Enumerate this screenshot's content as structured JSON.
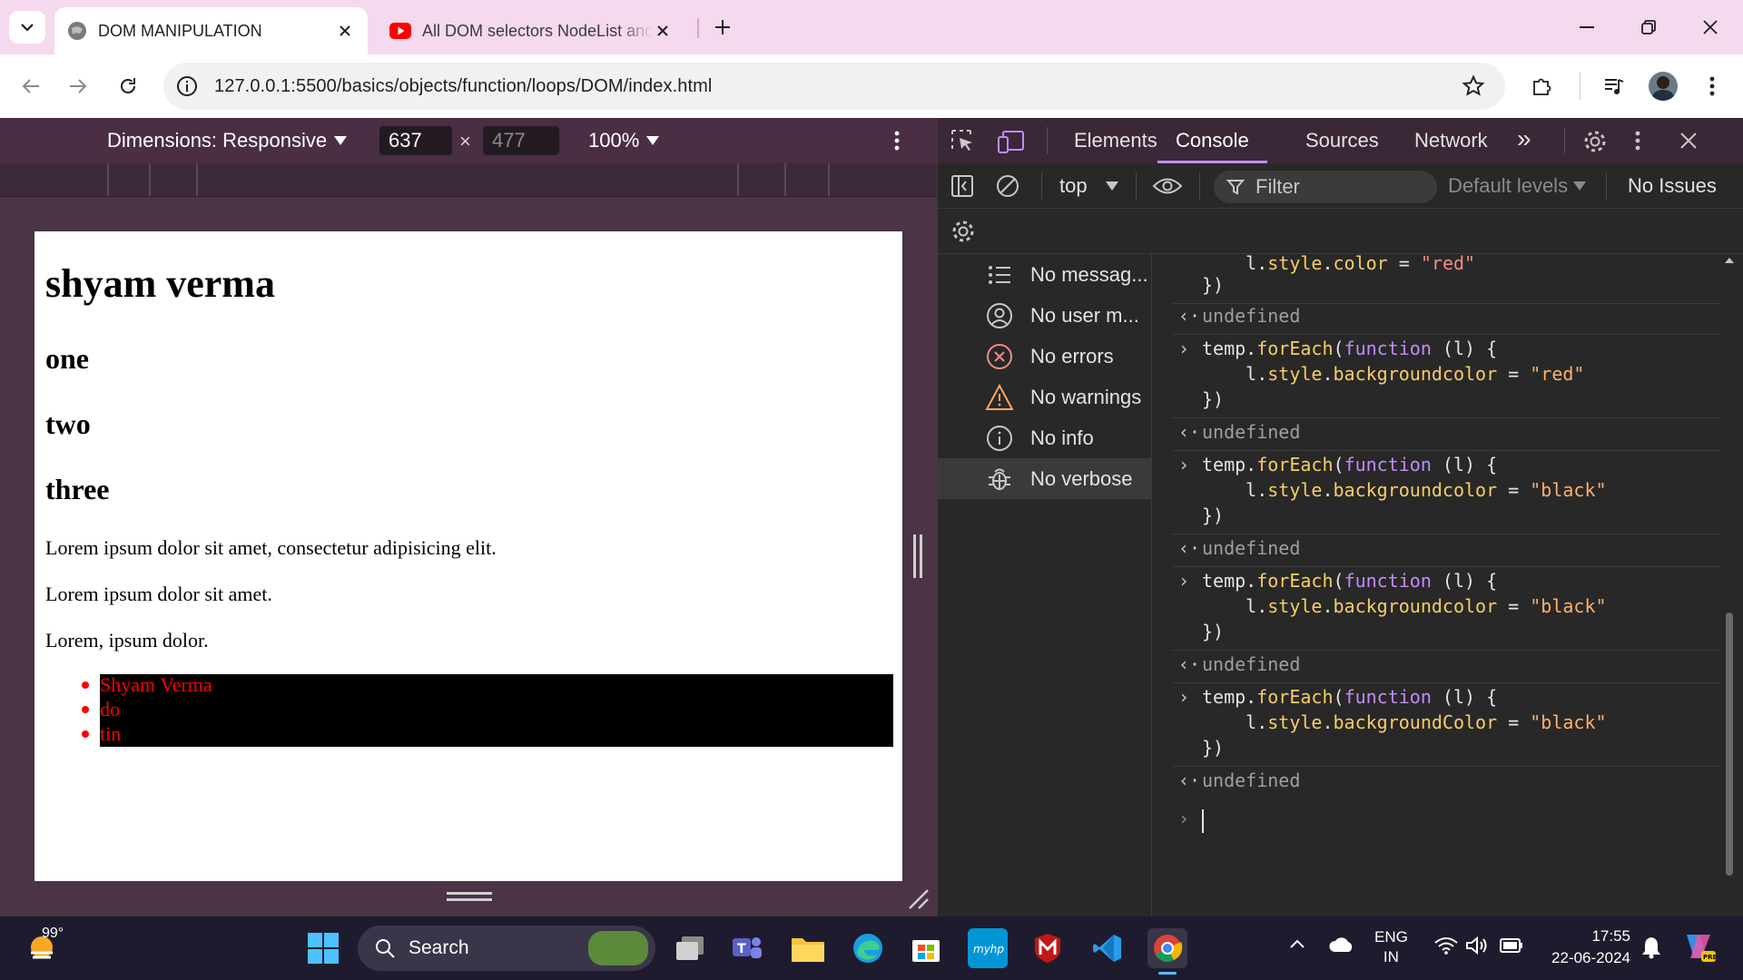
{
  "browser": {
    "tabs": [
      {
        "title": "DOM MANIPULATION",
        "active": true
      },
      {
        "title": "All DOM selectors NodeList and",
        "active": false
      }
    ],
    "url": "127.0.0.1:5500/basics/objects/function/loops/DOM/index.html"
  },
  "device_toolbar": {
    "dimensions_label": "Dimensions: Responsive",
    "width": "637",
    "height": "477",
    "times": "×",
    "zoom": "100%"
  },
  "page": {
    "h1": "shyam verma",
    "headings": [
      "one",
      "two",
      "three"
    ],
    "paragraphs": [
      "Lorem ipsum dolor sit amet, consectetur adipisicing elit.",
      "Lorem ipsum dolor sit amet.",
      "Lorem, ipsum dolor."
    ],
    "list_items": [
      "Shyam Verma",
      "do",
      "tin"
    ]
  },
  "devtools": {
    "tabs": [
      "Elements",
      "Console",
      "Sources",
      "Network"
    ],
    "active_tab": "Console",
    "more_tabs": "»",
    "context": "top",
    "filter_placeholder": "Filter",
    "levels": "Default levels",
    "issues": "No Issues",
    "sidebar": [
      {
        "label": "No messag...",
        "icon": "list-icon"
      },
      {
        "label": "No user m...",
        "icon": "user-icon"
      },
      {
        "label": "No errors",
        "icon": "error-icon"
      },
      {
        "label": "No warnings",
        "icon": "warning-icon"
      },
      {
        "label": "No info",
        "icon": "info-icon"
      },
      {
        "label": "No verbose",
        "icon": "bug-icon"
      }
    ],
    "console": {
      "undefined": "undefined",
      "entries": [
        {
          "prop": "backgroundcolor",
          "value": "\"red\""
        },
        {
          "prop": "backgroundcolor",
          "value": "\"black\""
        },
        {
          "prop": "backgroundcolor",
          "value": "\"black\""
        },
        {
          "prop": "backgroundColor",
          "value": "\"black\""
        }
      ],
      "top_partial": {
        "prop": "color",
        "value": "\"red\""
      }
    }
  },
  "taskbar": {
    "weather": "99°",
    "search": "Search",
    "lang1": "ENG",
    "lang2": "IN",
    "time": "17:55",
    "date": "22-06-2024"
  },
  "colors": {
    "accent": "#c58af9",
    "tabstrip": "#f5d9ee",
    "list_text": "#ff0000"
  }
}
